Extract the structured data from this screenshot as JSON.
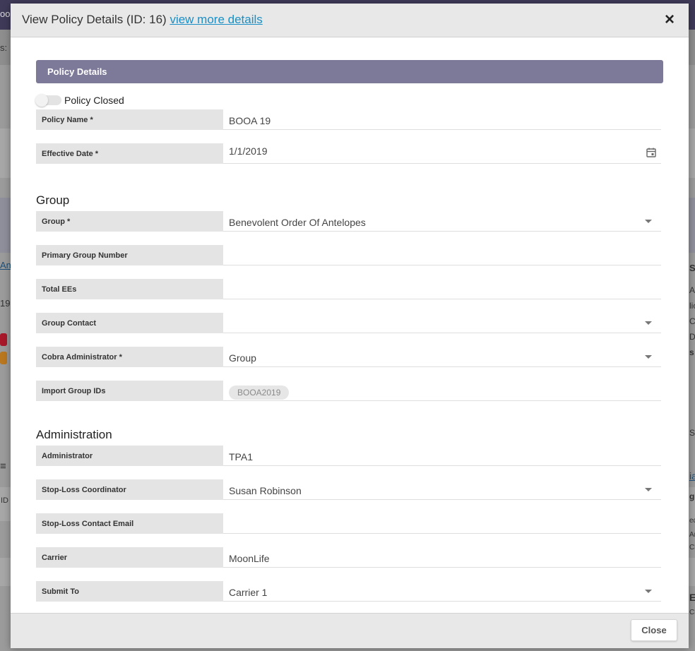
{
  "background": {
    "fragments": [
      "oo",
      "s:",
      "An",
      "19",
      "ID",
      "S",
      "An",
      "lic",
      "C",
      "D",
      "s",
      "S",
      "ia",
      "g",
      "ed",
      "Ar",
      "Cla",
      "E",
      "Cla"
    ]
  },
  "modal": {
    "title_prefix": "View Policy Details (ID: 16)",
    "title_link": "view more details",
    "close_symbol": "×",
    "section_title": "Policy Details",
    "toggle_label": "Policy Closed",
    "fields": {
      "policy_name": {
        "label": "Policy Name *",
        "value": "BOOA 19"
      },
      "effective_date": {
        "label": "Effective Date *",
        "value": "1/1/2019"
      }
    },
    "group_heading": "Group",
    "group_fields": {
      "group": {
        "label": "Group *",
        "value": "Benevolent Order Of Antelopes"
      },
      "primary_group_number": {
        "label": "Primary Group Number",
        "value": ""
      },
      "total_ees": {
        "label": "Total EEs",
        "value": ""
      },
      "group_contact": {
        "label": "Group Contact",
        "value": ""
      },
      "cobra_administrator": {
        "label": "Cobra Administrator *",
        "value": "Group"
      },
      "import_group_ids": {
        "label": "Import Group IDs",
        "chip": "BOOA2019"
      }
    },
    "admin_heading": "Administration",
    "admin_fields": {
      "administrator": {
        "label": "Administrator",
        "value": "TPA1"
      },
      "stop_loss_coordinator": {
        "label": "Stop-Loss Coordinator",
        "value": "Susan Robinson"
      },
      "stop_loss_contact_email": {
        "label": "Stop-Loss Contact Email",
        "value": ""
      },
      "carrier": {
        "label": "Carrier",
        "value": "MoonLife"
      },
      "submit_to": {
        "label": "Submit To",
        "value": "Carrier 1"
      }
    },
    "footer_close_label": "Close"
  },
  "colors": {
    "section_bar": "#7d7999",
    "link": "#1a8fc6",
    "app_header": "#3e3a58"
  }
}
